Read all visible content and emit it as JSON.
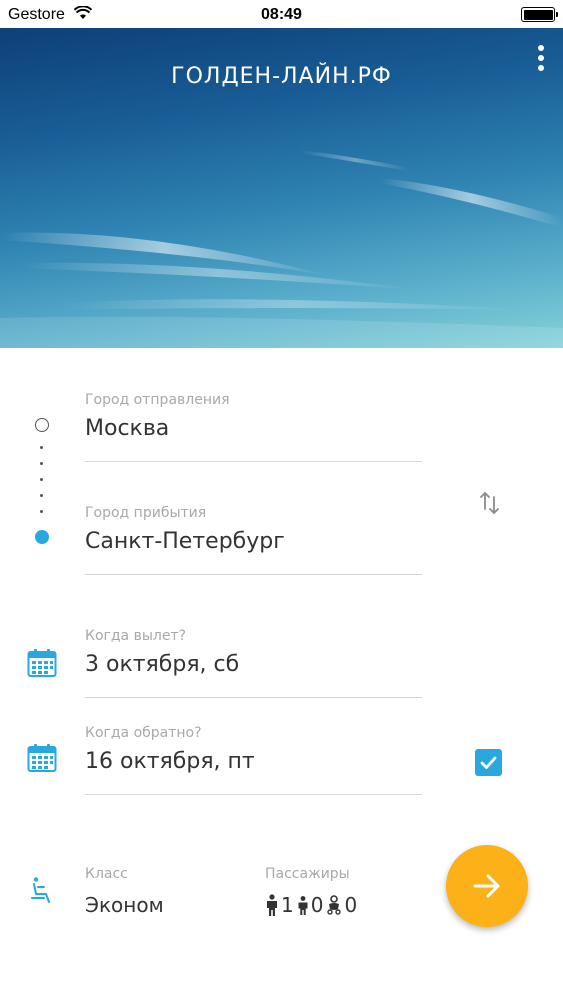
{
  "status_bar": {
    "carrier": "Gestore",
    "time": "08:49",
    "battery_level": 1.0
  },
  "header": {
    "title": "ГОЛДЕН-ЛАЙН.РФ",
    "menu_icon": "more-vertical-icon"
  },
  "route": {
    "origin": {
      "label": "Город отправления",
      "value": "Москва"
    },
    "destination": {
      "label": "Город прибытия",
      "value": "Санкт-Петербург"
    },
    "swap_icon": "swap-vertical-icon"
  },
  "dates": {
    "departure": {
      "label": "Когда вылет?",
      "value": "3 октября, сб"
    },
    "return": {
      "label": "Когда обратно?",
      "value": "16 октября, пт",
      "enabled": true
    }
  },
  "options": {
    "class": {
      "label": "Класс",
      "value": "Эконом"
    },
    "passengers": {
      "label": "Пассажиры",
      "adults": "1",
      "children": "0",
      "infants": "0"
    }
  },
  "search_button": {
    "icon": "arrow-right-icon"
  },
  "colors": {
    "accent_blue": "#29a8e0",
    "fab_orange": "#fbb117"
  }
}
